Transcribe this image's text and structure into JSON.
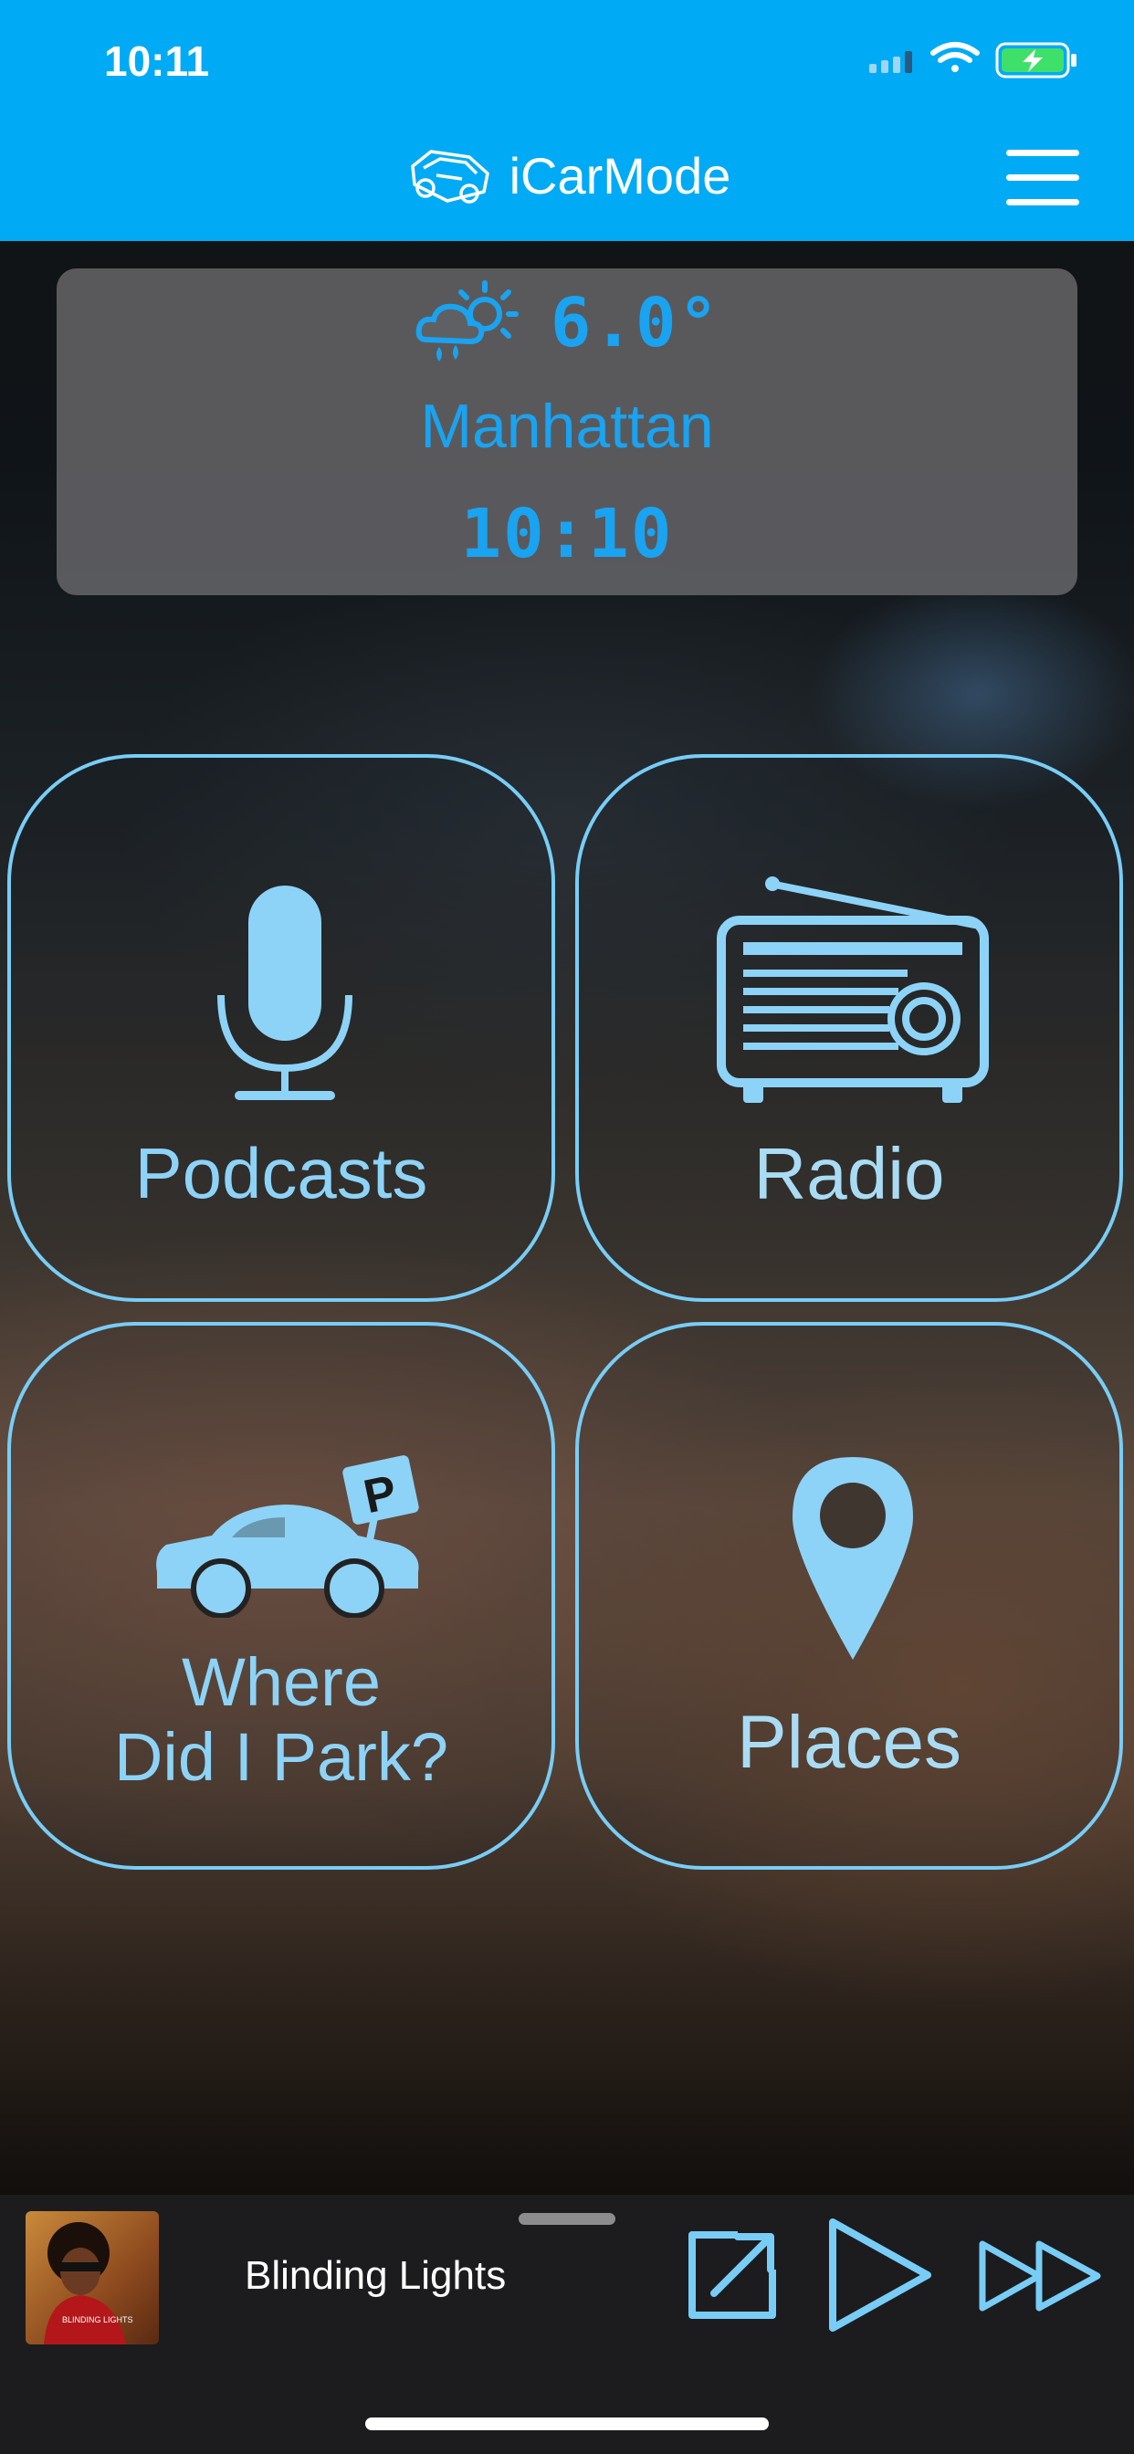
{
  "status_bar": {
    "time": "10:11"
  },
  "nav": {
    "title": "iCarMode"
  },
  "weather": {
    "temperature": "6.0°",
    "city": "Manhattan",
    "time": "10:10"
  },
  "tiles": [
    {
      "label": "Podcasts",
      "icon": "microphone-icon"
    },
    {
      "label": "Radio",
      "icon": "radio-icon"
    },
    {
      "label_line1": "Where",
      "label_line2": "Did I Park?",
      "icon": "parked-car-icon"
    },
    {
      "label": "Places",
      "icon": "map-pin-icon"
    }
  ],
  "player": {
    "track_title": "Blinding Lights",
    "album_art_text": "BLINDING LIGHTS"
  },
  "colors": {
    "accent": "#00aaf5",
    "tile_outline": "#78cdf6",
    "tile_label": "#8dd3f7",
    "weather_text": "#1aa3f0"
  }
}
